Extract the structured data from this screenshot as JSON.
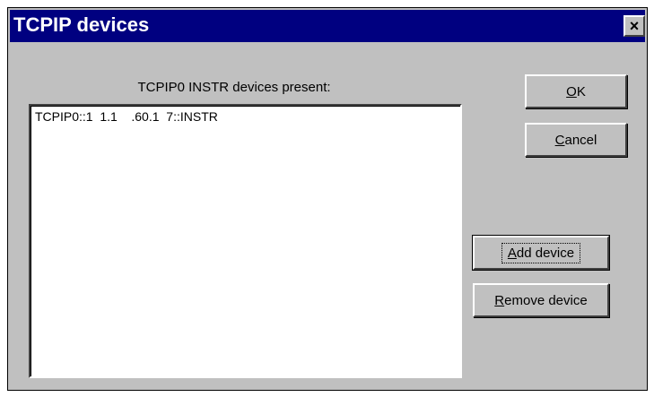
{
  "window": {
    "title": "TCPIP devices",
    "close_label": "×"
  },
  "list": {
    "label": "TCPIP0 INSTR devices present:",
    "items": [
      "TCPIP0::1  1.1    .60.1  7::INSTR"
    ]
  },
  "buttons": {
    "ok": {
      "accel": "O",
      "rest": "K"
    },
    "cancel": {
      "accel": "C",
      "rest": "ancel"
    },
    "add": {
      "accel": "A",
      "rest": "dd device"
    },
    "remove": {
      "accel": "R",
      "rest": "emove device"
    }
  },
  "colors": {
    "titlebar": "#000080",
    "face": "#c0c0c0"
  }
}
